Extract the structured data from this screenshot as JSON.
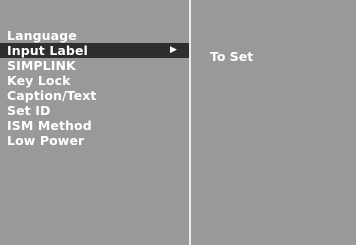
{
  "menu": {
    "items": [
      {
        "label": "Language"
      },
      {
        "label": "Input Label",
        "selected": true
      },
      {
        "label": "SIMPLINK"
      },
      {
        "label": "Key Lock"
      },
      {
        "label": "Caption/Text"
      },
      {
        "label": "Set ID"
      },
      {
        "label": "ISM Method"
      },
      {
        "label": "Low Power"
      }
    ],
    "arrow": "▶",
    "arrow_icon": "right-triangle-icon"
  },
  "submenu": {
    "label": "To Set"
  },
  "colors": {
    "panel": "#999999",
    "selected_row": "#2e2e2e",
    "text": "#ffffff",
    "divider": "#ececec"
  }
}
